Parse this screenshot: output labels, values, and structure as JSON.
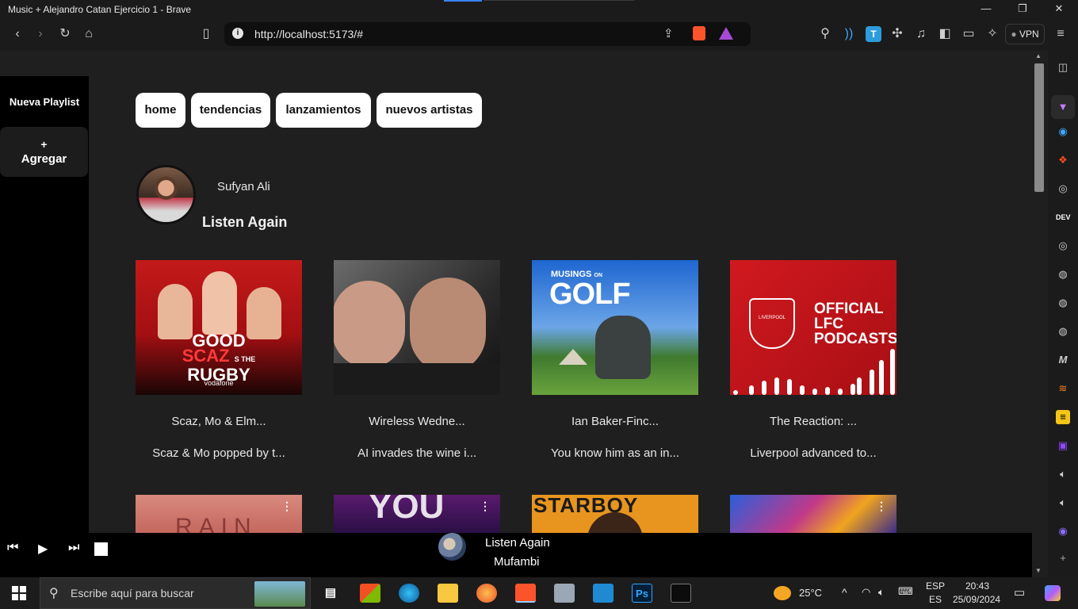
{
  "window": {
    "title": "Music + Alejandro Catan Ejercicio 1 - Brave",
    "minimize": "—",
    "maximize": "❐",
    "close": "✕"
  },
  "browser": {
    "url": "http://localhost:5173/#",
    "vpn_label": "VPN",
    "sidebar_icons": [
      "sidebar-toggle-icon",
      "leo-icon",
      "brave-news-icon",
      "figma-icon",
      "web-icon",
      "dev-icon",
      "web-icon",
      "globe-icon",
      "globe-icon",
      "globe-icon",
      "medium-icon",
      "stackoverflow-icon",
      "notes-icon",
      "twitch-icon",
      "speaker-icon",
      "speaker-icon",
      "podcast-icon",
      "add-icon"
    ],
    "dev_label": "DEV"
  },
  "app": {
    "sidebar": {
      "new_playlist": "Nueva Playlist",
      "add_plus": "+",
      "add_label": "Agregar"
    },
    "nav": [
      "home",
      "tendencias",
      "lanzamientos",
      "nuevos artistas"
    ],
    "user": {
      "name": "Sufyan Ali"
    },
    "section_title": "Listen Again",
    "cards": [
      {
        "title": "Scaz, Mo & Elm...",
        "description": "Scaz & Mo popped by t...",
        "cover_text": [
          "GOOD",
          "SCAZ",
          "RUGBY",
          "vodafone"
        ],
        "cover_text_small": "S THE"
      },
      {
        "title": "Wireless Wedne...",
        "description": "AI invades the wine i...",
        "cover_text": []
      },
      {
        "title": "Ian Baker-Finc...",
        "description": "You know him as an in...",
        "cover_text": [
          "MUSINGS",
          "GOLF"
        ],
        "cover_text_small": "ON"
      },
      {
        "title": "The Reaction: ...",
        "description": "Liverpool advanced to...",
        "cover_text": [
          "OFFICIAL",
          "LFC",
          "PODCASTS",
          "LIVERPOOL"
        ]
      }
    ],
    "second_row": [
      {
        "cover_text": "RAIN",
        "menu": "⋮"
      },
      {
        "cover_text": "YOU",
        "menu": "⋮"
      },
      {
        "cover_text": "STARBOY",
        "menu": "⋮"
      },
      {
        "cover_text": "",
        "menu": "⋮"
      }
    ],
    "player": {
      "prev": "⏮",
      "play": "▶",
      "next": "⏭",
      "title": "Listen Again",
      "artist": "Mufambi"
    }
  },
  "taskbar": {
    "search_placeholder": "Escribe aquí para buscar",
    "weather": "25°C",
    "lang_top": "ESP",
    "lang_bottom": "ES",
    "time": "20:43",
    "date": "25/09/2024",
    "ps_label": "Ps"
  },
  "colors": {
    "background": "#1f1f1f",
    "sidebar": "#000000",
    "nav_button": "#ffffff",
    "accent": "#3b82f6"
  }
}
